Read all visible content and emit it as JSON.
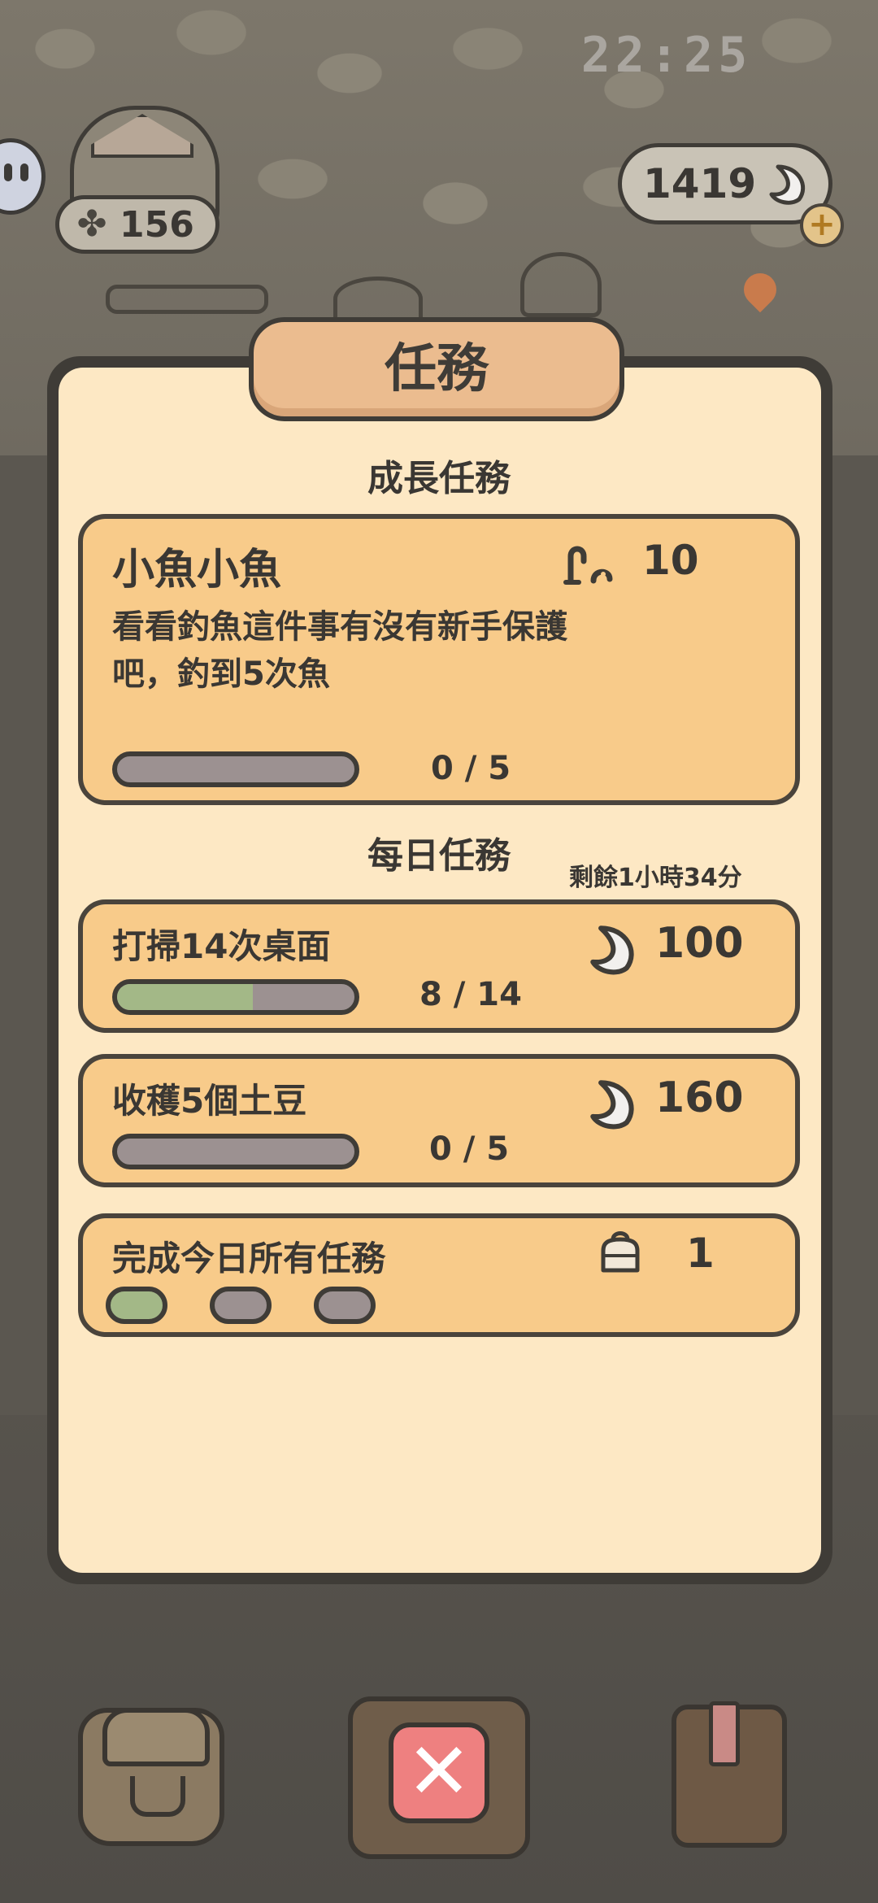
{
  "status_bar": {
    "time": "22:25"
  },
  "hud": {
    "clover_count": "156",
    "currency_amount": "1419",
    "add_label": "+"
  },
  "modal": {
    "title": "任務",
    "growth": {
      "section_title": "成長任務",
      "task": {
        "name": "小魚小魚",
        "description_line1": "看看釣魚這件事有沒有新手保護",
        "description_line2": "吧，釣到5次魚",
        "reward_icon": "worm-icon",
        "reward_amount": "10",
        "progress_text": "0 / 5",
        "progress": 0.0
      }
    },
    "daily": {
      "section_title": "每日任務",
      "remaining_time": "剩餘1小時34分",
      "tasks": [
        {
          "name": "打掃14次桌面",
          "reward_icon": "moon-coin-icon",
          "reward_amount": "100",
          "progress_text": "8 / 14",
          "progress": 0.571
        },
        {
          "name": "收穫5個土豆",
          "reward_icon": "moon-coin-icon",
          "reward_amount": "160",
          "progress_text": "0 / 5",
          "progress": 0.0
        }
      ],
      "all_complete": {
        "name": "完成今日所有任務",
        "reward_icon": "bag-icon",
        "reward_amount": "1",
        "steps": [
          true,
          false,
          false
        ]
      }
    }
  },
  "bottom_nav": {
    "close_label": "✕",
    "left_icon": "backpack-icon",
    "right_icon": "journal-icon"
  },
  "colors": {
    "panel_bg": "#fde8c4",
    "card_bg": "#f8cb8a",
    "progress_fill": "#a3b887",
    "progress_track": "#9c9191",
    "close_red": "#ee8080",
    "outline": "#3f3c37"
  }
}
